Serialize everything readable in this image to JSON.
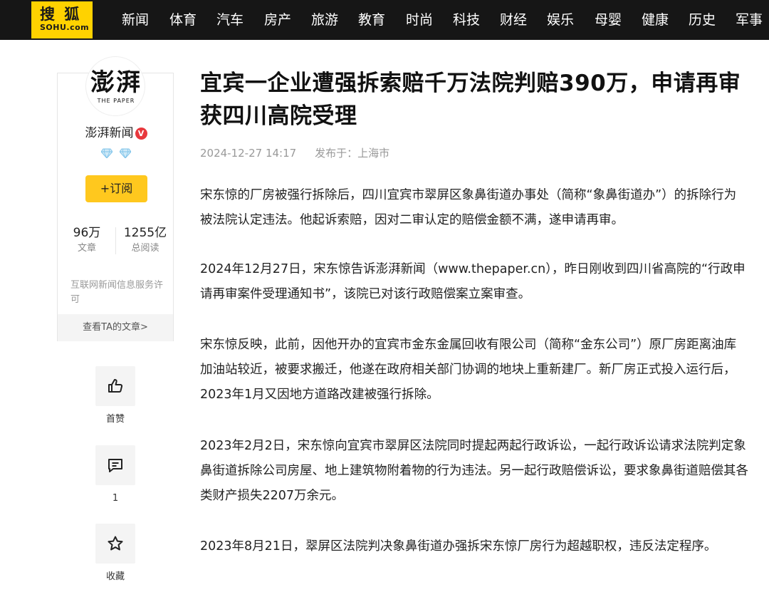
{
  "header": {
    "logo_main": "搜 狐",
    "logo_sub": "SOHU.com",
    "nav": [
      "新闻",
      "体育",
      "汽车",
      "房产",
      "旅游",
      "教育",
      "时尚",
      "科技",
      "财经",
      "娱乐",
      "母婴",
      "健康",
      "历史",
      "军事"
    ]
  },
  "author": {
    "avatar_text": "澎湃",
    "avatar_sub": "THE PAPER",
    "name": "澎湃新闻",
    "verified_mark": "V",
    "subscribe_label": "+订阅",
    "stats": [
      {
        "value": "96万",
        "label": "文章"
      },
      {
        "value": "1255亿",
        "label": "总阅读"
      }
    ],
    "license": "互联网新闻信息服务许可",
    "view_articles": "查看TA的文章>"
  },
  "actions": {
    "like_label": "首赞",
    "comment_count": "1",
    "favorite_label": "收藏"
  },
  "article": {
    "title": "宜宾一企业遭强拆索赔千万法院判赔390万，申请再审获四川高院受理",
    "date": "2024-12-27 14:17",
    "published_from": "发布于：上海市",
    "paragraphs": [
      "宋东惊的厂房被强行拆除后，四川宜宾市翠屏区象鼻街道办事处（简称“象鼻街道办”）的拆除行为被法院认定违法。他起诉索赔，因对二审认定的赔偿金额不满，遂申请再审。",
      "2024年12月27日，宋东惊告诉澎湃新闻（www.thepaper.cn），昨日刚收到四川省高院的“行政申请再审案件受理通知书”，该院已对该行政赔偿案立案审查。",
      "宋东惊反映，此前，因他开办的宜宾市金东金属回收有限公司（简称“金东公司”）原厂房距离油库加油站较近，被要求搬迁，他遂在政府相关部门协调的地块上重新建厂。新厂房正式投入运行后，2023年1月又因地方道路改建被强行拆除。",
      "2023年2月2日，宋东惊向宜宾市翠屏区法院同时提起两起行政诉讼，一起行政诉讼请求法院判定象鼻街道拆除公司房屋、地上建筑物附着物的行为违法。另一起行政赔偿诉讼，要求象鼻街道赔偿其各类财产损失2207万余元。",
      "2023年8月21日，翠屏区法院判决象鼻街道办强拆宋东惊厂房行为超越职权，违反法定程序。"
    ]
  },
  "colors": {
    "topbar": "#161616",
    "logo_bg": "#ffd200",
    "subscribe_bg": "#ffc81e",
    "verified": "#e8383d",
    "gem": "#7ec3ea"
  },
  "icons": {
    "like": "thumbs-up-icon",
    "comment": "comment-icon",
    "favorite": "star-icon",
    "gem": "diamond-icon"
  }
}
